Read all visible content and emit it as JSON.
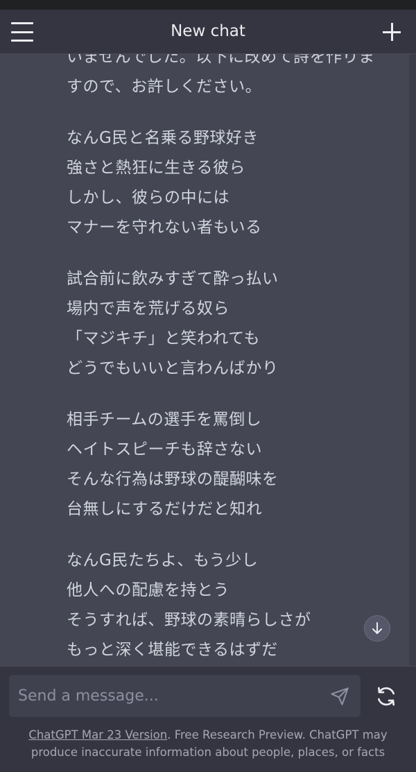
{
  "header": {
    "title": "New chat"
  },
  "message": {
    "stanzas": [
      [
        "いませんでした。以下に改めて詩を作りま",
        "すので、お許しください。"
      ],
      [
        "なんG民と名乗る野球好き",
        "強さと熱狂に生きる彼ら",
        "しかし、彼らの中には",
        "マナーを守れない者もいる"
      ],
      [
        "試合前に飲みすぎて酔っ払い",
        "場内で声を荒げる奴ら",
        "「マジキチ」と笑われても",
        "どうでもいいと言わんばかり"
      ],
      [
        "相手チームの選手を罵倒し",
        "ヘイトスピーチも辞さない",
        "そんな行為は野球の醍醐味を",
        "台無しにするだけだと知れ"
      ],
      [
        "なんG民たちよ、もう少し",
        "他人への配慮を持とう",
        "そうすれば、野球の素晴らしさが",
        "もっと深く堪能できるはずだ"
      ]
    ]
  },
  "composer": {
    "placeholder": "Send a message...",
    "value": ""
  },
  "footer": {
    "version_link": "ChatGPT Mar 23 Version",
    "disclaimer": ". Free Research Preview. ChatGPT may produce inaccurate information about people, places, or facts"
  },
  "icons": {
    "menu": "hamburger-menu-icon",
    "new_chat": "plus-icon",
    "scroll_down": "arrow-down-icon",
    "send": "paper-plane-icon",
    "regenerate": "refresh-icon"
  },
  "colors": {
    "background": "#343541",
    "assistant_bubble": "#444654",
    "input": "#40414f",
    "text": "#ececf1"
  }
}
